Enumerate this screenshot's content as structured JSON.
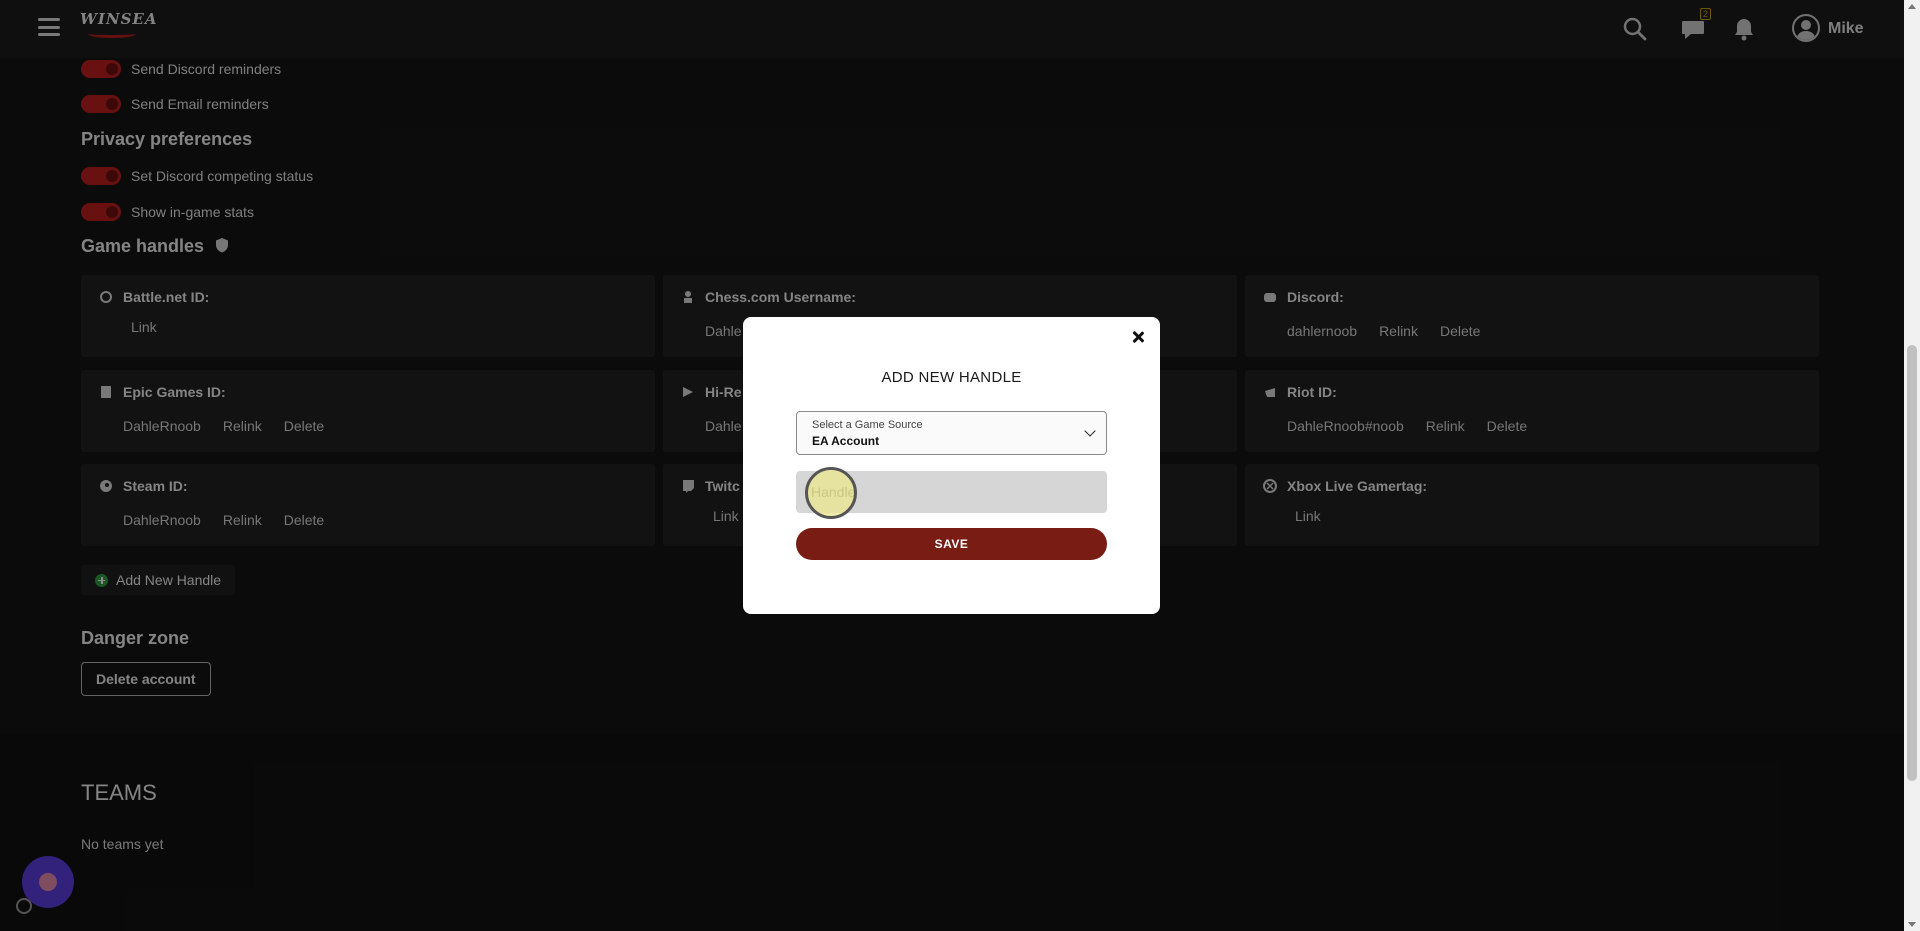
{
  "header": {
    "logo_text": "WINSEA",
    "username": "Mike",
    "chat_badge": "2"
  },
  "notifications": {
    "toggles": [
      "Send Discord reminders",
      "Send Email reminders"
    ]
  },
  "privacy": {
    "title": "Privacy preferences",
    "toggles": [
      "Set Discord competing status",
      "Show in-game stats"
    ]
  },
  "game_handles": {
    "title": "Game handles",
    "cards": [
      {
        "label": "Battle.net ID:",
        "actions": [
          "Link"
        ],
        "value": ""
      },
      {
        "label": "Chess.com Username:",
        "value": "Dahle",
        "actions": []
      },
      {
        "label": "Discord:",
        "value": "dahlernoob",
        "actions": [
          "Relink",
          "Delete"
        ]
      },
      {
        "label": "Epic Games ID:",
        "value": "DahleRnoob",
        "actions": [
          "Relink",
          "Delete"
        ]
      },
      {
        "label": "Hi-Re",
        "value": "Dahle",
        "actions": []
      },
      {
        "label": "Riot ID:",
        "value": "DahleRnoob#noob",
        "actions": [
          "Relink",
          "Delete"
        ]
      },
      {
        "label": "Steam ID:",
        "value": "DahleRnoob",
        "actions": [
          "Relink",
          "Delete"
        ]
      },
      {
        "label": "Twitc",
        "value": "",
        "actions": [
          "Link"
        ]
      },
      {
        "label": "Xbox Live Gamertag:",
        "value": "",
        "actions": [
          "Link"
        ]
      }
    ],
    "add_label": "Add New Handle"
  },
  "danger": {
    "title": "Danger zone",
    "delete_label": "Delete account"
  },
  "teams": {
    "title": "TEAMS",
    "empty": "No teams yet"
  },
  "modal": {
    "title": "ADD NEW HANDLE",
    "select_label": "Select a Game Source",
    "select_value": "EA Account",
    "handle_placeholder": "Handle",
    "handle_value": "",
    "save_label": "SAVE"
  },
  "colors": {
    "toggle_on": "#c0201e",
    "save_button": "#781c14",
    "add_icon": "#2ea043",
    "chat_widget": "#5b3fe0"
  }
}
